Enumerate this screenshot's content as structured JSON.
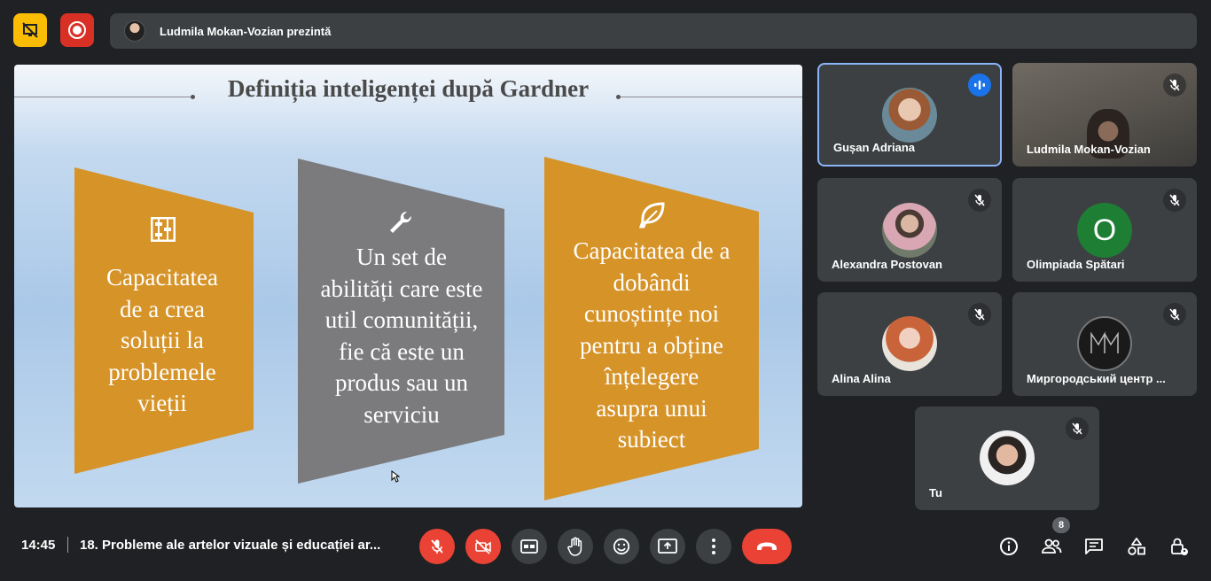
{
  "header": {
    "presenting_text": "Ludmila Mokan-Vozian prezintă"
  },
  "slide": {
    "title": "Definiția inteligenței după Gardner",
    "cards": [
      {
        "icon": "abacus-icon",
        "lines": [
          "Capacitatea",
          "de a crea",
          "soluții la",
          "problemele",
          "vieții"
        ]
      },
      {
        "icon": "wrench-icon",
        "lines": [
          "Un set de",
          "abilități care este",
          "util comunității,",
          "fie că este un",
          "produs sau un",
          "serviciu"
        ]
      },
      {
        "icon": "leaf-icon",
        "lines": [
          "Capacitatea de a",
          "dobândi",
          "cunoștințe noi",
          "pentru a obține",
          "înțelegere",
          "asupra unui",
          "subiect"
        ]
      }
    ]
  },
  "participants": [
    {
      "name": "Gușan Adriana",
      "speaking": true
    },
    {
      "name": "Ludmila Mokan-Vozian",
      "muted": true
    },
    {
      "name": "Alexandra Postovan",
      "muted": true
    },
    {
      "name": "Olimpiada Spătari",
      "muted": true,
      "initial": "O",
      "avatar_color": "#1e7e34"
    },
    {
      "name": "Alina Alina",
      "muted": true
    },
    {
      "name": "Миргородський центр ...",
      "muted": true
    },
    {
      "name": "Tu",
      "muted": true
    }
  ],
  "footer": {
    "time": "14:45",
    "meeting_title": "18. Probleme ale artelor vizuale și educației ar...",
    "participant_count": "8"
  },
  "colors": {
    "card_orange": "#d69328",
    "card_gray": "#7b7b7d",
    "accent_blue": "#8ab4f8",
    "danger_red": "#ea4335",
    "warn_yellow": "#fbbc04"
  }
}
